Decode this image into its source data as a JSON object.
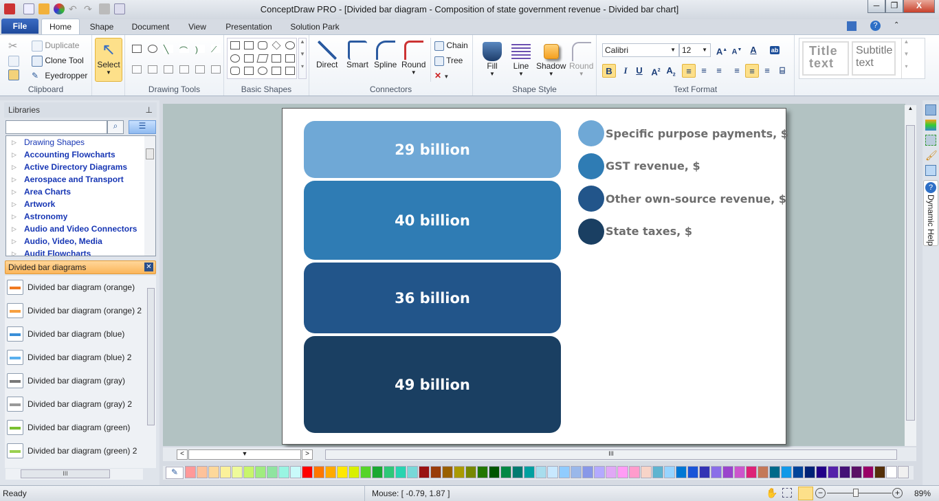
{
  "window": {
    "title": "ConceptDraw PRO - [Divided bar diagram - Composition of state government revenue - Divided bar chart]",
    "minimize": "─",
    "maximize": "❐",
    "close": "X"
  },
  "tabs": {
    "file": "File",
    "items": [
      "Home",
      "Shape",
      "Document",
      "View",
      "Presentation",
      "Solution Park"
    ]
  },
  "ribbon": {
    "clipboard": {
      "label": "Clipboard",
      "duplicate": "Duplicate",
      "clone": "Clone Tool",
      "eyedropper": "Eyedropper"
    },
    "select": {
      "label": "Select"
    },
    "drawing_tools": {
      "label": "Drawing Tools"
    },
    "basic_shapes": {
      "label": "Basic Shapes"
    },
    "connectors": {
      "label": "Connectors",
      "direct": "Direct",
      "smart": "Smart",
      "spline": "Spline",
      "round": "Round",
      "chain": "Chain",
      "tree": "Tree"
    },
    "shape_style": {
      "label": "Shape Style",
      "fill": "Fill",
      "line": "Line",
      "shadow": "Shadow",
      "round": "Round"
    },
    "text_format": {
      "label": "Text Format",
      "font": "Calibri",
      "size": "12",
      "bold": "B",
      "italic": "I",
      "underline": "U"
    },
    "styles": {
      "title": "Title text",
      "subtitle": "Subtitle text"
    }
  },
  "libraries": {
    "header": "Libraries",
    "search_placeholder": "",
    "items": [
      "Drawing Shapes",
      "Accounting Flowcharts",
      "Active Directory Diagrams",
      "Aerospace and Transport",
      "Area Charts",
      "Artwork",
      "Astronomy",
      "Audio and Video Connectors",
      "Audio, Video, Media",
      "Audit Flowcharts"
    ]
  },
  "open_library": {
    "name": "Divided bar diagrams",
    "shapes": [
      {
        "label": "Divided bar diagram (orange)",
        "color": "#f07a20"
      },
      {
        "label": "Divided bar diagram (orange) 2",
        "color": "#f7a040"
      },
      {
        "label": "Divided bar diagram (blue)",
        "color": "#3a8fd8"
      },
      {
        "label": "Divided bar diagram (blue) 2",
        "color": "#5ab0ee"
      },
      {
        "label": "Divided bar diagram (gray)",
        "color": "#777777"
      },
      {
        "label": "Divided bar diagram (gray) 2",
        "color": "#999999"
      },
      {
        "label": "Divided bar diagram (green)",
        "color": "#7ac030"
      },
      {
        "label": "Divided bar diagram (green) 2",
        "color": "#9ad050"
      }
    ]
  },
  "diagram": {
    "segments": [
      {
        "label": "29 billion",
        "value": 29,
        "legend": "Specific purpose payments, $",
        "color": "#6fa8d6"
      },
      {
        "label": "40 billion",
        "value": 40,
        "legend": "GST revenue, $",
        "color": "#2f7cb4"
      },
      {
        "label": "36 billion",
        "value": 36,
        "legend": "Other own-source revenue, $",
        "color": "#22558a"
      },
      {
        "label": "49 billion",
        "value": 49,
        "legend": "State taxes, $",
        "color": "#1a3f62"
      }
    ]
  },
  "right_panel": {
    "dynamic_help": "Dynamic Help"
  },
  "palette": [
    "#ff9999",
    "#fdc29a",
    "#fdd89a",
    "#fbf19a",
    "#eefa9a",
    "#c8f56b",
    "#a0ec80",
    "#8fe4a0",
    "#99f5e2",
    "#c9fafa",
    "#ff0000",
    "#ff7700",
    "#ffaa00",
    "#ffe800",
    "#d8f000",
    "#55d42a",
    "#1aa832",
    "#2ec878",
    "#28d4b0",
    "#78d8d8",
    "#991111",
    "#993c0a",
    "#996000",
    "#aa9a00",
    "#778800",
    "#227700",
    "#005500",
    "#008844",
    "#007a70",
    "#00a0a0",
    "#a8dded",
    "#c8e8ff",
    "#90ccff",
    "#9ab8ea",
    "#8898e8",
    "#b4aaff",
    "#e0a8f5",
    "#ff9cf5",
    "#ff9ccc",
    "#f8d4c8",
    "#5fb4d0",
    "#98d4ff",
    "#0077d4",
    "#1a55d8",
    "#3333b4",
    "#8a6ee8",
    "#9a44cc",
    "#cc55cc",
    "#dd2277",
    "#c47858",
    "#006a8a",
    "#1199e8",
    "#00449a",
    "#002277",
    "#220088",
    "#5522aa",
    "#441177",
    "#5a1166",
    "#990066",
    "#55300a",
    "#ffffff",
    "#f0f0f0"
  ],
  "status": {
    "ready": "Ready",
    "mouse": "Mouse: [ -0.79, 1.87 ]",
    "zoom": "89%",
    "zoom_fraction": 0.45
  }
}
